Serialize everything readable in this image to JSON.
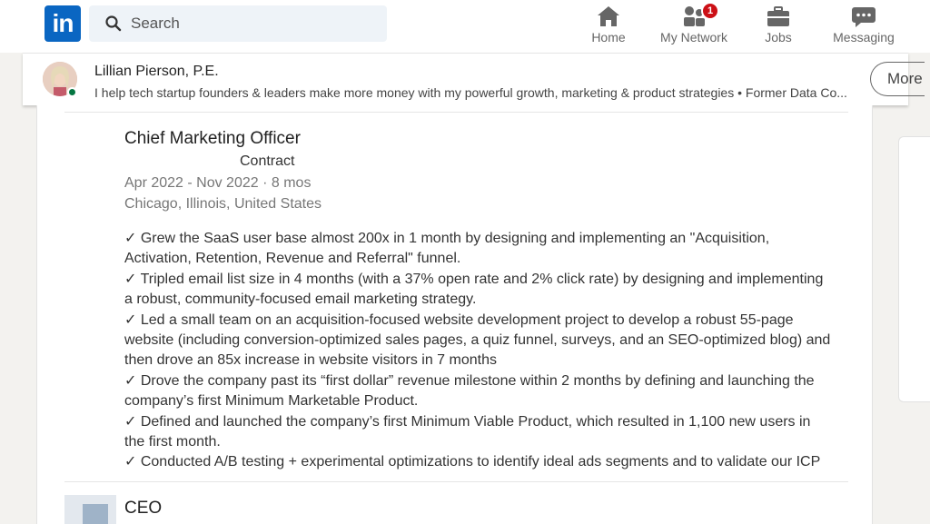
{
  "nav": {
    "search_placeholder": "Search",
    "items": [
      {
        "label": "Home",
        "icon": "home-icon"
      },
      {
        "label": "My Network",
        "icon": "network-icon",
        "badge": "1"
      },
      {
        "label": "Jobs",
        "icon": "briefcase-icon"
      },
      {
        "label": "Messaging",
        "icon": "messaging-icon"
      }
    ],
    "brand_color": "#0a66c2",
    "logo_text": "in"
  },
  "profile": {
    "name": "Lillian Pierson, P.E.",
    "tagline": "I help tech startup founders & leaders make more money with my powerful growth, marketing & product strategies • Former Data Co...",
    "more_label": "More"
  },
  "experience": {
    "title": "Chief Marketing Officer",
    "employment_type": "Contract",
    "dates": "Apr 2022 - Nov 2022 · 8 mos",
    "location": "Chicago, Illinois, United States",
    "description_lines": [
      "✓ Grew the SaaS user base almost 200x in 1 month by designing and implementing an \"Acquisition,",
      "Activation, Retention, Revenue and Referral\" funnel.",
      "✓ Tripled email list size in 4 months (with a 37% open rate and 2% click rate) by designing and implementing",
      "a robust, community-focused email marketing strategy.",
      "✓ Led a small team on an acquisition-focused website development project to develop a robust 55-page",
      "website (including conversion-optimized sales pages, a quiz funnel, surveys, and an SEO-optimized blog) and",
      "then drove an 85x increase in website visitors in 7 months",
      "✓ Drove the company past its “first dollar” revenue milestone within 2 months by defining and launching the",
      "company’s first Minimum Marketable Product.",
      "✓ Defined and launched the company’s first Minimum Viable Product, which resulted in 1,100 new users in",
      "the first month.",
      "✓ Conducted A/B testing + experimental optimizations to identify ideal ads segments and to validate our ICP"
    ],
    "next_title": "CEO"
  }
}
